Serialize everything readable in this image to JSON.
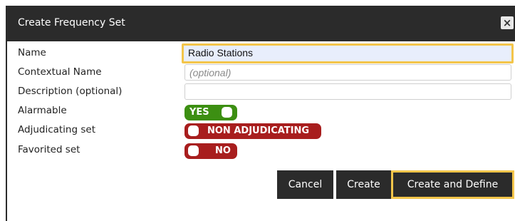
{
  "dialog": {
    "title": "Create Frequency Set",
    "close_label": "×"
  },
  "form": {
    "name_label": "Name",
    "name_value": "Radio Stations",
    "contextual_label": "Contextual Name",
    "contextual_placeholder": "(optional)",
    "description_label": "Description (optional)",
    "description_value": "",
    "alarmable_label": "Alarmable",
    "alarmable_state": "YES",
    "adjudicating_label": "Adjudicating set",
    "adjudicating_state": "NON ADJUDICATING",
    "favorited_label": "Favorited set",
    "favorited_state": "NO"
  },
  "buttons": {
    "cancel": "Cancel",
    "create": "Create",
    "create_define": "Create and Define"
  },
  "colors": {
    "titlebar": "#2b2b2b",
    "highlight": "#f3c54a",
    "toggle_on": "#3c8f12",
    "toggle_off": "#a81e1e"
  }
}
